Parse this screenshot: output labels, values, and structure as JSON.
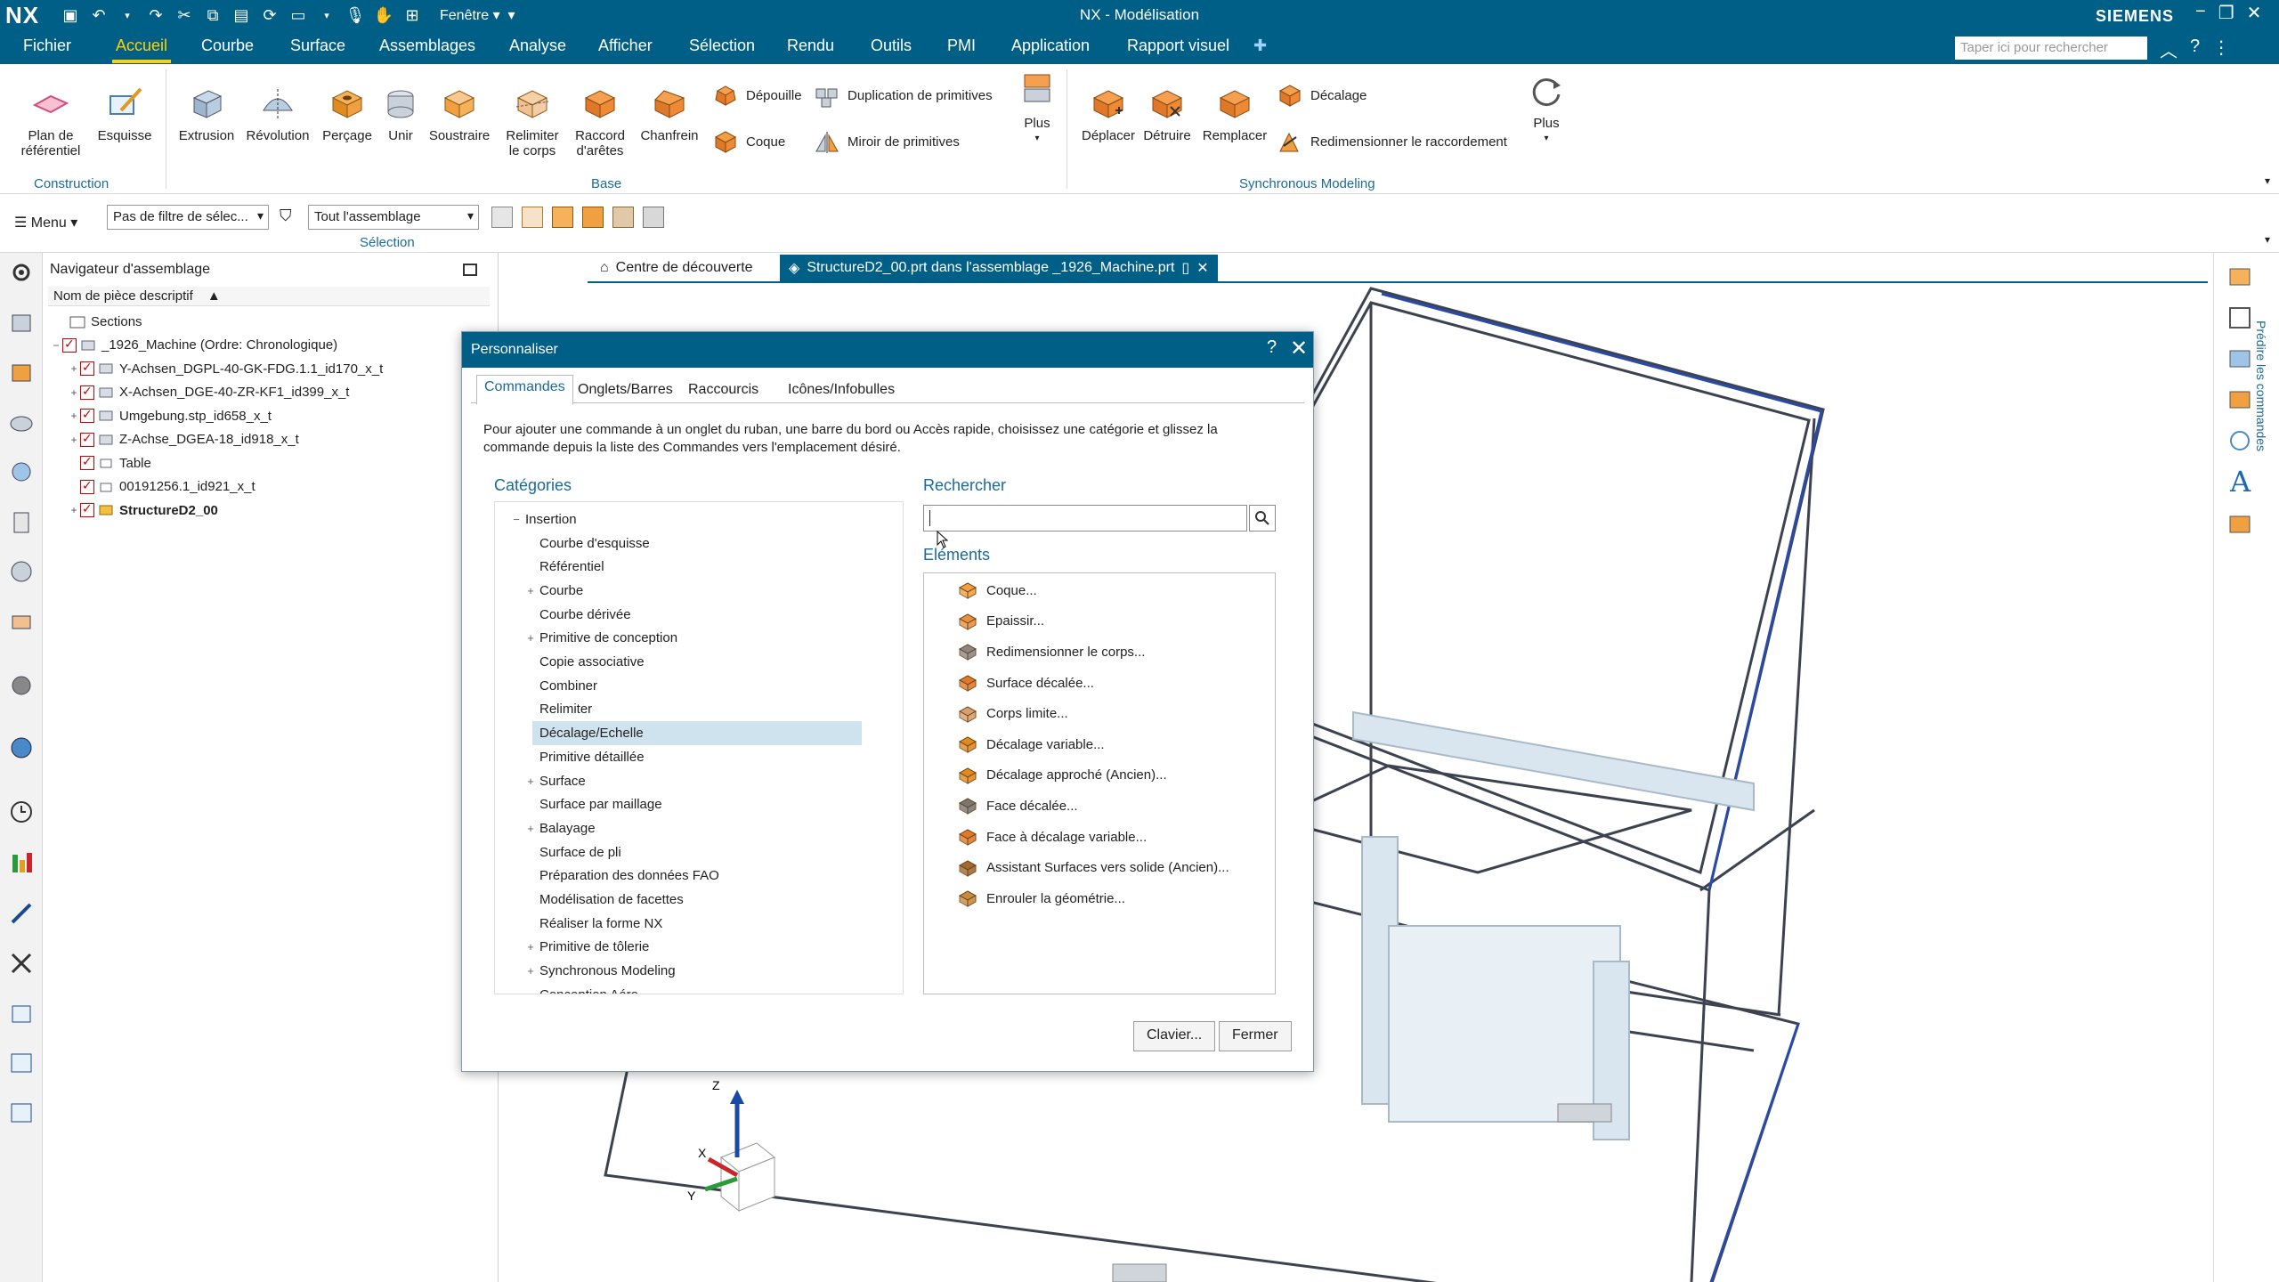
{
  "app": {
    "logo": "NX",
    "window_menu": "Fenêtre",
    "title": "NX - Modélisation",
    "brand": "SIEMENS"
  },
  "menu": {
    "tabs": [
      "Fichier",
      "Accueil",
      "Courbe",
      "Surface",
      "Assemblages",
      "Analyse",
      "Afficher",
      "Sélection",
      "Rendu",
      "Outils",
      "PMI",
      "Application",
      "Rapport visuel"
    ],
    "active": "Accueil",
    "search_placeholder": "Taper ici pour rechercher"
  },
  "ribbon": {
    "construction": {
      "plan": "Plan de\nréférentiel",
      "esquisse": "Esquisse",
      "label": "Construction"
    },
    "base": {
      "extrusion": "Extrusion",
      "revolution": "Révolution",
      "percage": "Perçage",
      "unir": "Unir",
      "soustraire": "Soustraire",
      "relimiter": "Relimiter\nle corps",
      "raccord": "Raccord\nd'arêtes",
      "chanfrein": "Chanfrein",
      "depouille": "Dépouille",
      "coque": "Coque",
      "duplication": "Duplication de primitives",
      "miroir": "Miroir de primitives",
      "plus": "Plus",
      "label": "Base"
    },
    "sync": {
      "deplacer": "Déplacer",
      "detruire": "Détruire",
      "remplacer": "Remplacer",
      "decalage": "Décalage",
      "redim": "Redimensionner le raccordement",
      "plus": "Plus",
      "label": "Synchronous Modeling"
    }
  },
  "selection_bar": {
    "menu": "Menu",
    "filter": "Pas de filtre de sélec...",
    "scope": "Tout l'assemblage",
    "label": "Sélection"
  },
  "navigator": {
    "title": "Navigateur d'assemblage",
    "column": "Nom de pièce descriptif",
    "rows": [
      {
        "label": "Sections",
        "indent": 0,
        "check": false,
        "expand": ""
      },
      {
        "label": "_1926_Machine (Ordre: Chronologique)",
        "indent": 0,
        "check": true,
        "expand": "−"
      },
      {
        "label": "Y-Achsen_DGPL-40-GK-FDG.1.1_id170_x_t",
        "indent": 1,
        "check": true,
        "expand": "+"
      },
      {
        "label": "X-Achsen_DGE-40-ZR-KF1_id399_x_t",
        "indent": 1,
        "check": true,
        "expand": "+"
      },
      {
        "label": "Umgebung.stp_id658_x_t",
        "indent": 1,
        "check": true,
        "expand": "+"
      },
      {
        "label": "Z-Achse_DGEA-18_id918_x_t",
        "indent": 1,
        "check": true,
        "expand": "+"
      },
      {
        "label": "Table",
        "indent": 1,
        "check": true,
        "expand": ""
      },
      {
        "label": "00191256.1_id921_x_t",
        "indent": 1,
        "check": true,
        "expand": ""
      },
      {
        "label": "StructureD2_00",
        "indent": 1,
        "check": true,
        "expand": "+",
        "bold": true
      }
    ]
  },
  "graphics_tabs": {
    "discovery": "Centre de découverte",
    "file": "StructureD2_00.prt dans l'assemblage _1926_Machine.prt"
  },
  "right_bar": {
    "label": "Prédire les commandes"
  },
  "dialog": {
    "title": "Personnaliser",
    "tabs": [
      "Commandes",
      "Onglets/Barres",
      "Raccourcis",
      "Icônes/Infobulles"
    ],
    "description": "Pour ajouter une commande à un onglet du ruban, une barre du bord ou Accès rapide, choisissez une catégorie et glissez la commande depuis la liste des Commandes vers l'emplacement désiré.",
    "categories_label": "Catégories",
    "search_label": "Rechercher",
    "elements_label": "Eléments",
    "categories": [
      {
        "label": "Insertion",
        "level": 0,
        "pl": "−"
      },
      {
        "label": "Courbe d'esquisse",
        "level": 1,
        "pl": ""
      },
      {
        "label": "Référentiel",
        "level": 1,
        "pl": ""
      },
      {
        "label": "Courbe",
        "level": 1,
        "pl": "+"
      },
      {
        "label": "Courbe dérivée",
        "level": 1,
        "pl": ""
      },
      {
        "label": "Primitive de conception",
        "level": 1,
        "pl": "+"
      },
      {
        "label": "Copie associative",
        "level": 1,
        "pl": ""
      },
      {
        "label": "Combiner",
        "level": 1,
        "pl": ""
      },
      {
        "label": "Relimiter",
        "level": 1,
        "pl": ""
      },
      {
        "label": "Décalage/Echelle",
        "level": 1,
        "pl": "",
        "selected": true
      },
      {
        "label": "Primitive détaillée",
        "level": 1,
        "pl": ""
      },
      {
        "label": "Surface",
        "level": 1,
        "pl": "+"
      },
      {
        "label": "Surface par maillage",
        "level": 1,
        "pl": ""
      },
      {
        "label": "Balayage",
        "level": 1,
        "pl": "+"
      },
      {
        "label": "Surface de pli",
        "level": 1,
        "pl": ""
      },
      {
        "label": "Préparation des données FAO",
        "level": 1,
        "pl": ""
      },
      {
        "label": "Modélisation de facettes",
        "level": 1,
        "pl": ""
      },
      {
        "label": "Réaliser la forme NX",
        "level": 1,
        "pl": ""
      },
      {
        "label": "Primitive de tôlerie",
        "level": 1,
        "pl": "+"
      },
      {
        "label": "Synchronous Modeling",
        "level": 1,
        "pl": "+"
      },
      {
        "label": "Conception Aéro",
        "level": 1,
        "pl": ""
      }
    ],
    "elements": [
      {
        "label": "Coque...",
        "icon": "shell-icon"
      },
      {
        "label": "Epaissir...",
        "icon": "thicken-icon"
      },
      {
        "label": "Redimensionner le corps...",
        "icon": "resize-body-icon"
      },
      {
        "label": "Surface décalée...",
        "icon": "offset-surface-icon"
      },
      {
        "label": "Corps limite...",
        "icon": "limit-body-icon"
      },
      {
        "label": "Décalage variable...",
        "icon": "variable-offset-icon"
      },
      {
        "label": "Décalage approché (Ancien)...",
        "icon": "approx-offset-icon"
      },
      {
        "label": "Face décalée...",
        "icon": "offset-face-icon"
      },
      {
        "label": "Face à décalage variable...",
        "icon": "variable-offset-face-icon"
      },
      {
        "label": "Assistant Surfaces vers solide (Ancien)...",
        "icon": "surfaces-to-solid-icon"
      },
      {
        "label": "Enrouler la géométrie...",
        "icon": "wrap-geometry-icon"
      }
    ],
    "btn_keyboard": "Clavier...",
    "btn_close": "Fermer"
  }
}
